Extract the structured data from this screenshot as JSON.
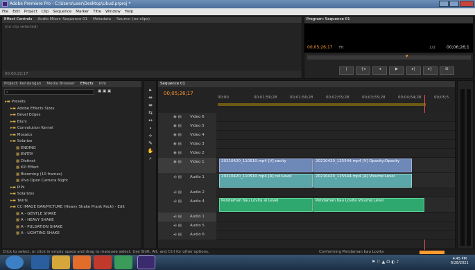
{
  "window": {
    "title": "Adobe Premiere Pro - C:\\Users\\user\\Desktop\\Ubud.prproj *"
  },
  "menu": [
    "File",
    "Edit",
    "Project",
    "Clip",
    "Sequence",
    "Marker",
    "Title",
    "Window",
    "Help"
  ],
  "source_panel": {
    "tabs": [
      "Effect Controls",
      "Audio Mixer: Sequence 01",
      "Metadata",
      "Source: (no clips)"
    ],
    "no_clip": "(no clip selected)",
    "time": "00:00:22:17"
  },
  "program": {
    "tab": "Program: Sequence 01",
    "timecode": "00;05;26;17",
    "fit": "Fit",
    "res": "1/2",
    "duration": "00;06;26;1"
  },
  "project": {
    "tabs": [
      "Project: Kendangan",
      "Media Browser",
      "Effects",
      "Info"
    ],
    "items": [
      {
        "label": "Presets",
        "indent": 0,
        "folder": true
      },
      {
        "label": "Adobe Effects Sizes",
        "indent": 1,
        "folder": true
      },
      {
        "label": "Bevel Edges",
        "indent": 1,
        "folder": true
      },
      {
        "label": "Blurs",
        "indent": 1,
        "folder": true
      },
      {
        "label": "Convolution Kernel",
        "indent": 1,
        "folder": true
      },
      {
        "label": "Mosaics",
        "indent": 1,
        "folder": true
      },
      {
        "label": "Solarize",
        "indent": 1,
        "folder": true
      },
      {
        "label": "ENDING",
        "indent": 2,
        "folder": false
      },
      {
        "label": "ENTRY",
        "indent": 2,
        "folder": false
      },
      {
        "label": "Distinct",
        "indent": 2,
        "folder": false
      },
      {
        "label": "Kill Effect",
        "indent": 2,
        "folder": false
      },
      {
        "label": "Blooming (10 frames)",
        "indent": 2,
        "folder": false
      },
      {
        "label": "Vivo Open Camera Night",
        "indent": 2,
        "folder": false
      },
      {
        "label": "PiPs",
        "indent": 1,
        "folder": true
      },
      {
        "label": "Solarizes",
        "indent": 1,
        "folder": true
      },
      {
        "label": "Twirls",
        "indent": 1,
        "folder": true
      },
      {
        "label": "CC IMAGE BAR/PICTURE (Heavy Shake Prank Pack) - Edit",
        "indent": 1,
        "folder": true
      },
      {
        "label": "A - GENTLE SHAKE",
        "indent": 2,
        "folder": false
      },
      {
        "label": "A - HEAVY SHAKE",
        "indent": 2,
        "folder": false
      },
      {
        "label": "A - PULSATION SHAKE",
        "indent": 2,
        "folder": false
      },
      {
        "label": "A - LIGHTING SHAKE",
        "indent": 2,
        "folder": false
      }
    ]
  },
  "sequence": {
    "tab": "Sequence 01",
    "timecode": "00;05;26;17",
    "ruler": [
      "00;00",
      "00;01;56;28",
      "00;01;56;28",
      "00;02;55;28",
      "00;03;55;28",
      "00;04;54;28",
      "00;05;5"
    ],
    "tracks": [
      {
        "name": "Video 6"
      },
      {
        "name": "Video 5"
      },
      {
        "name": "Video 4"
      },
      {
        "name": "Video 3"
      },
      {
        "name": "Video 2"
      },
      {
        "name": "Video 1"
      },
      {
        "name": "Audio 1"
      },
      {
        "name": "Audio 2"
      },
      {
        "name": "Audio 4"
      },
      {
        "name": "Audio 1"
      },
      {
        "name": "Audio 5"
      },
      {
        "name": "Audio 6"
      }
    ],
    "clips": {
      "v1a": "20210420_110510.mp4 [V] cacity",
      "v1b": "20210420_125544.mp4 [V] Opacity:Opacity",
      "a1a": "20210420_110510.mp4 [A] cel:Level",
      "a1b": "20210420_125544.mp4 [A] Volume:Level",
      "a4a": "Pendaman bau Lovita ai Level",
      "a4b": "Pendaman bau Lovita Volume:Level"
    }
  },
  "status": {
    "hint": "Click to select, or click in empty space and drag to marquee select. Use Shift, Alt, and Ctrl for other options.",
    "progress": "Conforming Pendaman bau Lovita"
  },
  "clock": {
    "time": "4:45 PM",
    "date": "6/28/2021"
  }
}
